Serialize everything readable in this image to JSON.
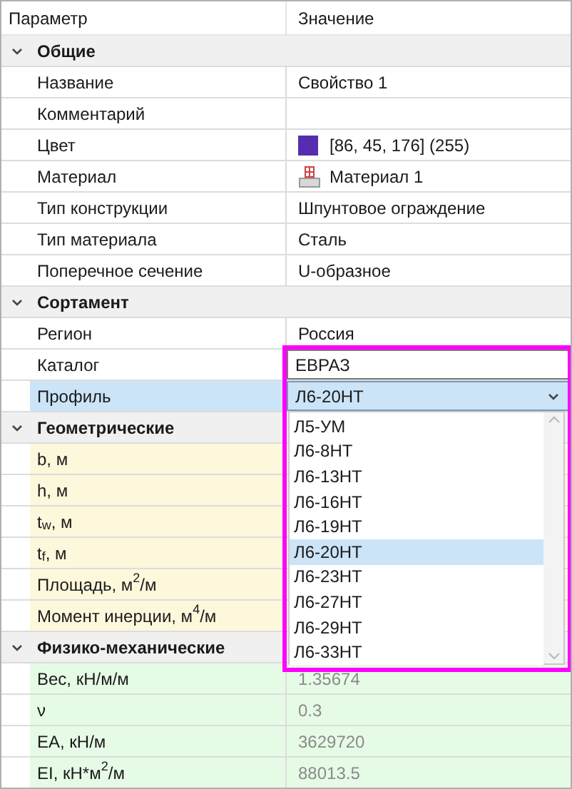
{
  "columns": [
    "Параметр",
    "Значение"
  ],
  "groups": [
    {
      "label": "Общие",
      "expanded": true,
      "color": "#ffffff",
      "rows": [
        {
          "label": "Название",
          "kind": "text",
          "value": "Свойство 1",
          "selected": false
        },
        {
          "label": "Комментарий",
          "kind": "text",
          "selected": false
        },
        {
          "label": "Цвет",
          "kind": "color",
          "value": "[86, 45, 176] (255)",
          "color": "#562db0",
          "selected": false
        },
        {
          "label": "Материал",
          "kind": "material",
          "value": "Материал 1",
          "selected": false
        },
        {
          "label": "Тип конструкции",
          "kind": "text",
          "value": "Шпунтовое ограждение",
          "selected": false
        },
        {
          "label": "Тип материала",
          "kind": "text",
          "value": "Сталь",
          "selected": false
        },
        {
          "label": "Поперечное сечение",
          "kind": "text",
          "value": "U-образное",
          "selected": false
        }
      ]
    },
    {
      "label": "Сортамент",
      "expanded": true,
      "color": "#ffffff",
      "rows": [
        {
          "label": "Регион",
          "kind": "text",
          "value": "Россия",
          "selected": false
        },
        {
          "label": "Каталог",
          "kind": "edit",
          "value": "ЕВРАЗ",
          "selected": false
        },
        {
          "label": "Профиль",
          "kind": "combo",
          "value": "Л6-20НТ",
          "selected": true,
          "open": true
        }
      ]
    },
    {
      "label": "Геометрические",
      "expanded": true,
      "color": "#fdf8dc",
      "rows": [
        {
          "label": "b, м",
          "kind": "text",
          "selected": false
        },
        {
          "label": "h, м",
          "kind": "text",
          "selected": false
        },
        {
          "label": "t$_{w}$, м",
          "kind": "text",
          "selected": false
        },
        {
          "label": "t$_{f}$, м",
          "kind": "text",
          "selected": false
        },
        {
          "label": "Площадь, м$^{2}$/м",
          "kind": "text",
          "selected": false
        },
        {
          "label": "Момент инерции, м$^{4}$/м",
          "kind": "text",
          "selected": false
        }
      ]
    },
    {
      "label": "Физико-механические",
      "expanded": true,
      "color": "#e6fbe6",
      "rows": [
        {
          "label": "Вес, кН/м/м",
          "kind": "text",
          "value": "1.35674",
          "disabled": true,
          "selected": false
        },
        {
          "label": "ν",
          "kind": "text",
          "value": "0.3",
          "disabled": true,
          "selected": false
        },
        {
          "label": "EA, кН/м",
          "kind": "text",
          "value": "3629720",
          "disabled": true,
          "selected": false
        },
        {
          "label": "EI, кН*м$^{2}$/м",
          "kind": "text",
          "value": "88013.5",
          "disabled": true,
          "selected": false
        }
      ]
    }
  ],
  "profile_options": [
    {
      "label": "Л5-УМ",
      "selected": false
    },
    {
      "label": "Л6-8НТ",
      "selected": false
    },
    {
      "label": "Л6-13НТ",
      "selected": false
    },
    {
      "label": "Л6-16НТ",
      "selected": false
    },
    {
      "label": "Л6-19НТ",
      "selected": false
    },
    {
      "label": "Л6-20НТ",
      "selected": true
    },
    {
      "label": "Л6-23НТ",
      "selected": false
    },
    {
      "label": "Л6-27НТ",
      "selected": false
    },
    {
      "label": "Л6-29НТ",
      "selected": false
    },
    {
      "label": "Л6-33НТ",
      "selected": false
    }
  ],
  "highlight_frame": true
}
